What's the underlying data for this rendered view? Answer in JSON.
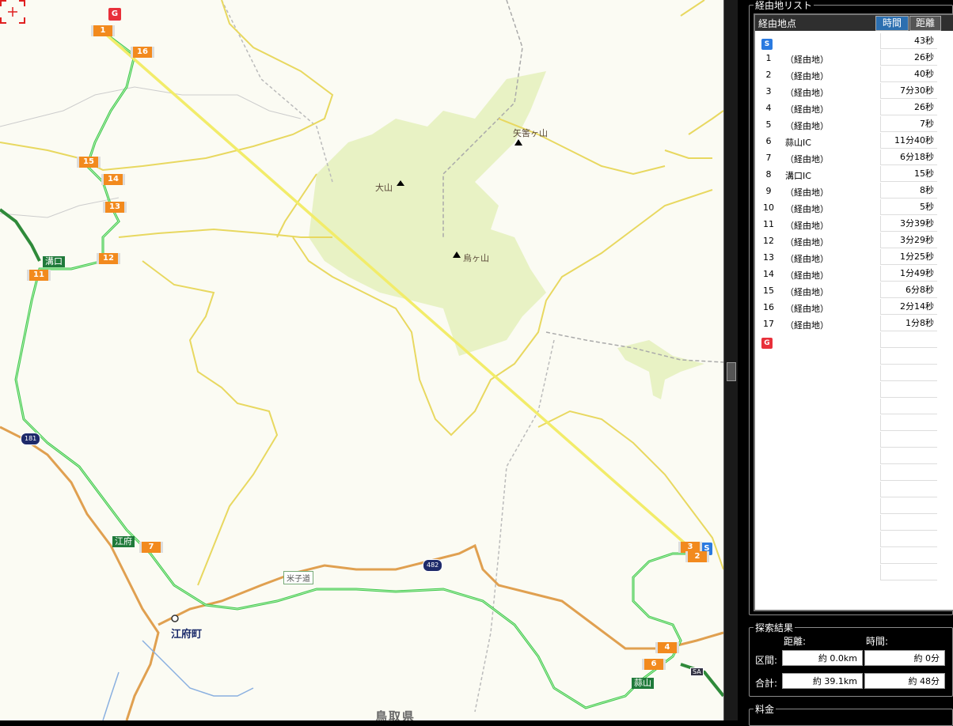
{
  "map": {
    "mountains": [
      "矢筈ヶ山",
      "大山",
      "烏ヶ山"
    ],
    "town": "江府町",
    "prefecture": "鳥取県",
    "ic_labels": [
      "溝口",
      "江府",
      "蒜山"
    ],
    "route_label": "米子道",
    "road_shields": [
      "181",
      "482"
    ],
    "sa_plate": "SA",
    "waypoint_markers": [
      "1",
      "16",
      "15",
      "14",
      "13",
      "12",
      "11",
      "7",
      "3",
      "2",
      "4",
      "6"
    ],
    "goal_flag": "G",
    "start_flag": "S"
  },
  "panel": {
    "list_title": "経由地リスト",
    "list_header": "経由地点",
    "tab_time": "時間",
    "tab_distance": "距離",
    "start_icon": "S",
    "goal_icon": "G",
    "rows": [
      {
        "n": "",
        "name": "",
        "time": "43秒"
      },
      {
        "n": "1",
        "name": "（経由地）",
        "time": "26秒"
      },
      {
        "n": "2",
        "name": "（経由地）",
        "time": "40秒"
      },
      {
        "n": "3",
        "name": "（経由地）",
        "time": "7分30秒"
      },
      {
        "n": "4",
        "name": "（経由地）",
        "time": "26秒"
      },
      {
        "n": "5",
        "name": "（経由地）",
        "time": "7秒"
      },
      {
        "n": "6",
        "name": "蒜山IC",
        "time": "11分40秒"
      },
      {
        "n": "7",
        "name": "（経由地）",
        "time": "6分18秒"
      },
      {
        "n": "8",
        "name": "溝口IC",
        "time": "15秒"
      },
      {
        "n": "9",
        "name": "（経由地）",
        "time": "8秒"
      },
      {
        "n": "10",
        "name": "（経由地）",
        "time": "5秒"
      },
      {
        "n": "11",
        "name": "（経由地）",
        "time": "3分39秒"
      },
      {
        "n": "12",
        "name": "（経由地）",
        "time": "3分29秒"
      },
      {
        "n": "13",
        "name": "（経由地）",
        "time": "1分25秒"
      },
      {
        "n": "14",
        "name": "（経由地）",
        "time": "1分49秒"
      },
      {
        "n": "15",
        "name": "（経由地）",
        "time": "6分8秒"
      },
      {
        "n": "16",
        "name": "（経由地）",
        "time": "2分14秒"
      },
      {
        "n": "17",
        "name": "（経由地）",
        "time": "1分8秒"
      }
    ],
    "result_title": "探索結果",
    "col_distance": "距離:",
    "col_time": "時間:",
    "section_label": "区間:",
    "section_distance": "約 0.0km",
    "section_time": "約 0分",
    "total_label": "合計:",
    "total_distance": "約 39.1km",
    "total_time": "約 48分",
    "fee_title": "料金"
  },
  "colors": {
    "route_green": "#3ec84a",
    "straight_line": "#f2ec6a",
    "park_green": "#e8f2c4",
    "orange_road": "#e0a050",
    "yellow_road": "#e8d860",
    "marker_orange": "#f28a1e"
  }
}
